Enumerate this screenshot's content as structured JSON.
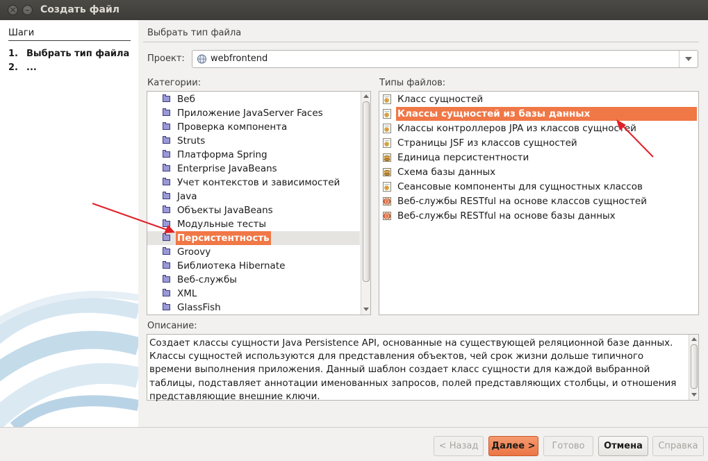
{
  "window": {
    "title": "Создать файл"
  },
  "steps": {
    "heading": "Шаги",
    "items": [
      {
        "num": "1.",
        "label": "Выбрать тип файла"
      },
      {
        "num": "2.",
        "label": "..."
      }
    ]
  },
  "main": {
    "section_title": "Выбрать тип файла",
    "project_label": "Проект:",
    "project_value": "webfrontend",
    "categories_label": "Категории:",
    "file_types_label": "Типы файлов:",
    "categories": [
      "Веб",
      "Приложение JavaServer Faces",
      "Проверка компонента",
      "Struts",
      "Платформа Spring",
      "Enterprise JavaBeans",
      "Учет контекстов и зависимостей",
      "Java",
      "Объекты JavaBeans",
      "Модульные тесты",
      "Персистентность",
      "Groovy",
      "Библиотека Hibernate",
      "Веб-службы",
      "XML",
      "GlassFish"
    ],
    "selected_category": "Персистентность",
    "file_types": [
      "Класс сущностей",
      "Классы сущностей из базы данных",
      "Классы контроллеров JPA из классов сущностей",
      "Страницы JSF из классов сущностей",
      "Единица персистентности",
      "Схема базы данных",
      "Сеансовые компоненты для сущностных классов",
      "Веб-службы RESTful на основе классов сущностей",
      "Веб-службы RESTful на основе базы данных"
    ],
    "selected_file_type": "Классы сущностей из базы данных",
    "description_label": "Описание:",
    "description": "Создает классы сущности Java Persistence API, основанные на существующей реляционной базе данных. Классы сущностей используются для представления объектов, чей срок жизни дольше типичного времени выполнения приложения. Данный шаблон создает класс сущности для каждой выбранной таблицы, подставляет аннотации именованных запросов, полей представляющих столбцы, и отношения представляющие внешние ключи."
  },
  "buttons": {
    "back": "< Назад",
    "next": "Далее >",
    "finish": "Готово",
    "cancel": "Отмена",
    "help": "Справка"
  },
  "colors": {
    "selection": "#f07746",
    "annotation_arrow": "#e0202a"
  }
}
